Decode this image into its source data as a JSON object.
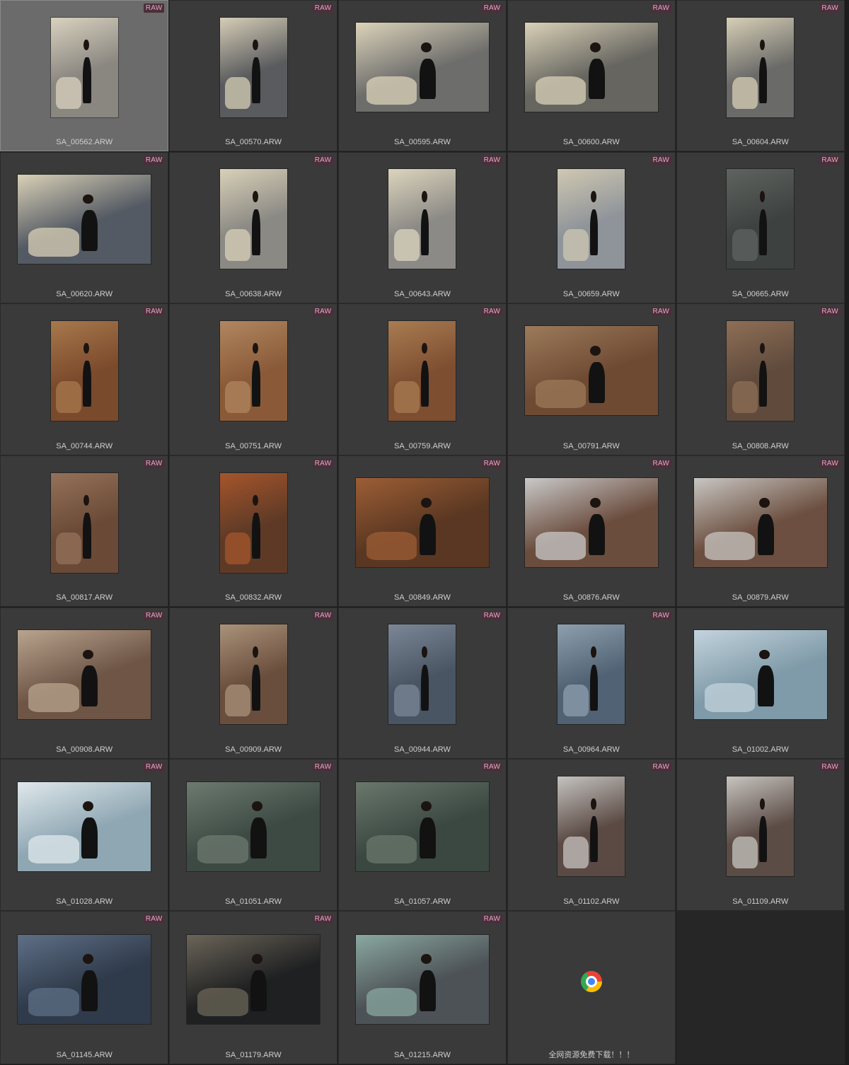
{
  "badge_label": "RAW",
  "items": [
    {
      "filename": "SA_00562.ARW",
      "orientation": "portrait",
      "tone": "#8a8680",
      "accent": "#d9d2bf",
      "raw": true,
      "selected": true
    },
    {
      "filename": "SA_00570.ARW",
      "orientation": "portrait",
      "tone": "#5a5b5e",
      "accent": "#d5cdb6",
      "raw": true
    },
    {
      "filename": "SA_00595.ARW",
      "orientation": "landscape",
      "tone": "#6d6d6b",
      "accent": "#dcd3ba",
      "raw": true
    },
    {
      "filename": "SA_00600.ARW",
      "orientation": "landscape",
      "tone": "#66655f",
      "accent": "#dad1b8",
      "raw": true
    },
    {
      "filename": "SA_00604.ARW",
      "orientation": "portrait",
      "tone": "#6a6a68",
      "accent": "#d7cfb6",
      "raw": true
    },
    {
      "filename": "SA_00620.ARW",
      "orientation": "landscape",
      "tone": "#545a63",
      "accent": "#d9d0b7",
      "raw": true
    },
    {
      "filename": "SA_00638.ARW",
      "orientation": "portrait",
      "tone": "#8b8984",
      "accent": "#d8d0b8",
      "raw": true
    },
    {
      "filename": "SA_00643.ARW",
      "orientation": "portrait",
      "tone": "#8c8a86",
      "accent": "#dcd4bd",
      "raw": true
    },
    {
      "filename": "SA_00659.ARW",
      "orientation": "portrait",
      "tone": "#8f949a",
      "accent": "#cfc8b2",
      "raw": true
    },
    {
      "filename": "SA_00665.ARW",
      "orientation": "portrait",
      "tone": "#3d4240",
      "accent": "#5f6360",
      "raw": true
    },
    {
      "filename": "SA_00744.ARW",
      "orientation": "portrait",
      "tone": "#7a4a2c",
      "accent": "#a8784c",
      "raw": true
    },
    {
      "filename": "SA_00751.ARW",
      "orientation": "portrait",
      "tone": "#8a5a38",
      "accent": "#b08660",
      "raw": true
    },
    {
      "filename": "SA_00759.ARW",
      "orientation": "portrait",
      "tone": "#7d4e30",
      "accent": "#a97c52",
      "raw": true
    },
    {
      "filename": "SA_00791.ARW",
      "orientation": "landscape",
      "tone": "#6e4a33",
      "accent": "#9c7a5a",
      "raw": true
    },
    {
      "filename": "SA_00808.ARW",
      "orientation": "portrait",
      "tone": "#5f4a3c",
      "accent": "#8e6f56",
      "raw": true
    },
    {
      "filename": "SA_00817.ARW",
      "orientation": "portrait",
      "tone": "#6a4a36",
      "accent": "#94715a",
      "raw": true
    },
    {
      "filename": "SA_00832.ARW",
      "orientation": "portrait",
      "tone": "#5e3a26",
      "accent": "#a5552c",
      "raw": true
    },
    {
      "filename": "SA_00849.ARW",
      "orientation": "landscape",
      "tone": "#5a3722",
      "accent": "#9c5e35",
      "raw": true
    },
    {
      "filename": "SA_00876.ARW",
      "orientation": "landscape",
      "tone": "#6b4d3e",
      "accent": "#c9c9c9",
      "raw": true
    },
    {
      "filename": "SA_00879.ARW",
      "orientation": "landscape",
      "tone": "#6c4f40",
      "accent": "#c8c6c2",
      "raw": true
    },
    {
      "filename": "SA_00908.ARW",
      "orientation": "landscape",
      "tone": "#6e5546",
      "accent": "#b8a48e",
      "raw": true
    },
    {
      "filename": "SA_00909.ARW",
      "orientation": "portrait",
      "tone": "#6a4e3d",
      "accent": "#aa9279",
      "raw": true
    },
    {
      "filename": "SA_00944.ARW",
      "orientation": "portrait",
      "tone": "#4a5564",
      "accent": "#7b8796",
      "raw": true
    },
    {
      "filename": "SA_00964.ARW",
      "orientation": "portrait",
      "tone": "#506273",
      "accent": "#8ea0ae",
      "raw": true
    },
    {
      "filename": "SA_01002.ARW",
      "orientation": "landscape",
      "tone": "#7f9aa8",
      "accent": "#c3d3dc",
      "raw": false
    },
    {
      "filename": "SA_01028.ARW",
      "orientation": "landscape",
      "tone": "#8fa7b3",
      "accent": "#dfe8ec",
      "raw": true
    },
    {
      "filename": "SA_01051.ARW",
      "orientation": "landscape",
      "tone": "#3d4a44",
      "accent": "#6d7a6f",
      "raw": true
    },
    {
      "filename": "SA_01057.ARW",
      "orientation": "landscape",
      "tone": "#3b4842",
      "accent": "#6a776c",
      "raw": true
    },
    {
      "filename": "SA_01102.ARW",
      "orientation": "portrait",
      "tone": "#5b4a44",
      "accent": "#c5c3c0",
      "raw": true
    },
    {
      "filename": "SA_01109.ARW",
      "orientation": "portrait",
      "tone": "#5c4c46",
      "accent": "#c7c4bf",
      "raw": true
    },
    {
      "filename": "SA_01145.ARW",
      "orientation": "landscape",
      "tone": "#2f3a4a",
      "accent": "#5e6f86",
      "raw": true
    },
    {
      "filename": "SA_01179.ARW",
      "orientation": "landscape",
      "tone": "#1f2022",
      "accent": "#6b6558",
      "raw": true
    },
    {
      "filename": "SA_01215.ARW",
      "orientation": "landscape",
      "tone": "#4d5256",
      "accent": "#8aa8a0",
      "raw": true
    },
    {
      "filename": "全网资源免费下载！！！",
      "orientation": "none",
      "icon": "chrome-icon",
      "raw": false
    },
    {
      "filename": "",
      "orientation": "empty",
      "raw": false
    }
  ]
}
